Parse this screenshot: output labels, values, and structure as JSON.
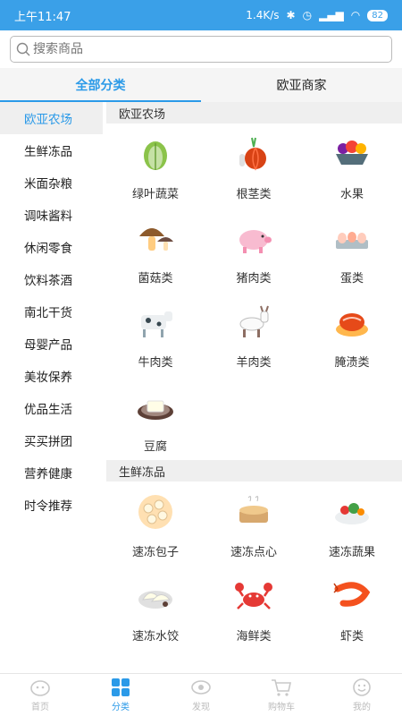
{
  "status_bar": {
    "time": "上午11:47",
    "speed": "1.4K/s",
    "battery": "82"
  },
  "search": {
    "placeholder": "搜索商品"
  },
  "tabs": [
    {
      "label": "全部分类"
    },
    {
      "label": "欧亚商家"
    }
  ],
  "sidebar": {
    "items": [
      {
        "label": "欧亚农场"
      },
      {
        "label": "生鲜冻品"
      },
      {
        "label": "米面杂粮"
      },
      {
        "label": "调味酱料"
      },
      {
        "label": "休闲零食"
      },
      {
        "label": "饮料茶酒"
      },
      {
        "label": "南北干货"
      },
      {
        "label": "母婴产品"
      },
      {
        "label": "美妆保养"
      },
      {
        "label": "优品生活"
      },
      {
        "label": "买买拼团"
      },
      {
        "label": "营养健康"
      },
      {
        "label": "时令推荐"
      }
    ]
  },
  "sections": [
    {
      "title": "欧亚农场",
      "items": [
        {
          "label": "绿叶蔬菜",
          "icon": "cabbage-icon"
        },
        {
          "label": "根茎类",
          "icon": "onion-icon"
        },
        {
          "label": "水果",
          "icon": "fruit-bowl-icon"
        },
        {
          "label": "菌菇类",
          "icon": "mushroom-icon"
        },
        {
          "label": "猪肉类",
          "icon": "pig-icon"
        },
        {
          "label": "蛋类",
          "icon": "eggs-icon"
        },
        {
          "label": "牛肉类",
          "icon": "cow-icon"
        },
        {
          "label": "羊肉类",
          "icon": "goat-icon"
        },
        {
          "label": "腌渍类",
          "icon": "kimchi-icon"
        },
        {
          "label": "豆腐",
          "icon": "tofu-icon"
        }
      ]
    },
    {
      "title": "生鲜冻品",
      "items": [
        {
          "label": "速冻包子",
          "icon": "buns-icon"
        },
        {
          "label": "速冻点心",
          "icon": "dimsum-icon"
        },
        {
          "label": "速冻蔬果",
          "icon": "veg-plate-icon"
        },
        {
          "label": "速冻水饺",
          "icon": "dumplings-icon"
        },
        {
          "label": "海鲜类",
          "icon": "crab-icon"
        },
        {
          "label": "虾类",
          "icon": "shrimp-icon"
        }
      ]
    }
  ],
  "bottom_nav": [
    {
      "label": "首页",
      "icon": "home-icon"
    },
    {
      "label": "分类",
      "icon": "category-grid-icon"
    },
    {
      "label": "发现",
      "icon": "eye-icon"
    },
    {
      "label": "购物车",
      "icon": "cart-icon"
    },
    {
      "label": "我的",
      "icon": "smile-icon"
    }
  ],
  "colors": {
    "accent": "#2b9ae8",
    "statusbar": "#3aa0e8"
  }
}
